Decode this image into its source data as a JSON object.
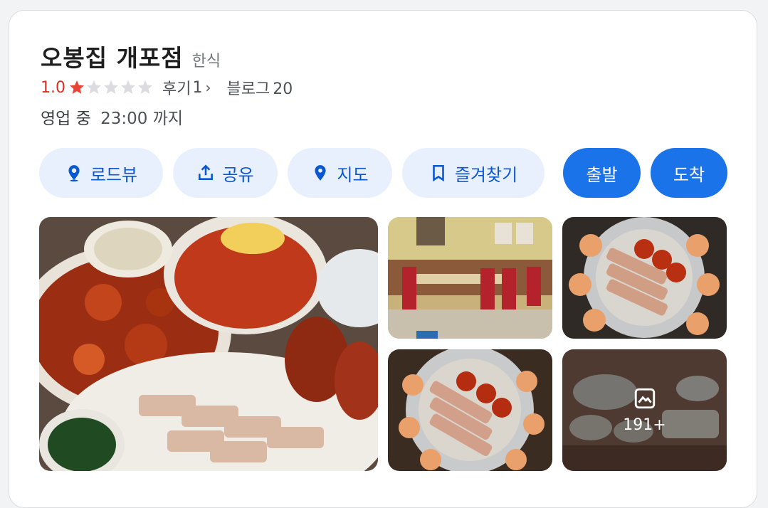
{
  "place": {
    "name": "오봉집 개포점",
    "category": "한식"
  },
  "rating": {
    "value": "1.0",
    "stars_filled": 1,
    "stars_total": 5,
    "star_color": "#ea4335",
    "star_empty_color": "#dadce0"
  },
  "reviews": {
    "label": "후기",
    "count": "1"
  },
  "blog": {
    "label": "블로그",
    "count": "20"
  },
  "hours": {
    "status": "영업 중",
    "time": "23:00 까지"
  },
  "actions": {
    "roadview": "로드뷰",
    "share": "공유",
    "map": "지도",
    "favorite": "즐겨찾기",
    "depart": "출발",
    "arrive": "도착"
  },
  "photos": {
    "more_count": "191+"
  },
  "colors": {
    "accent": "#1a73e8",
    "accent_light": "#e8f0fe",
    "accent_text": "#0b57d0"
  }
}
